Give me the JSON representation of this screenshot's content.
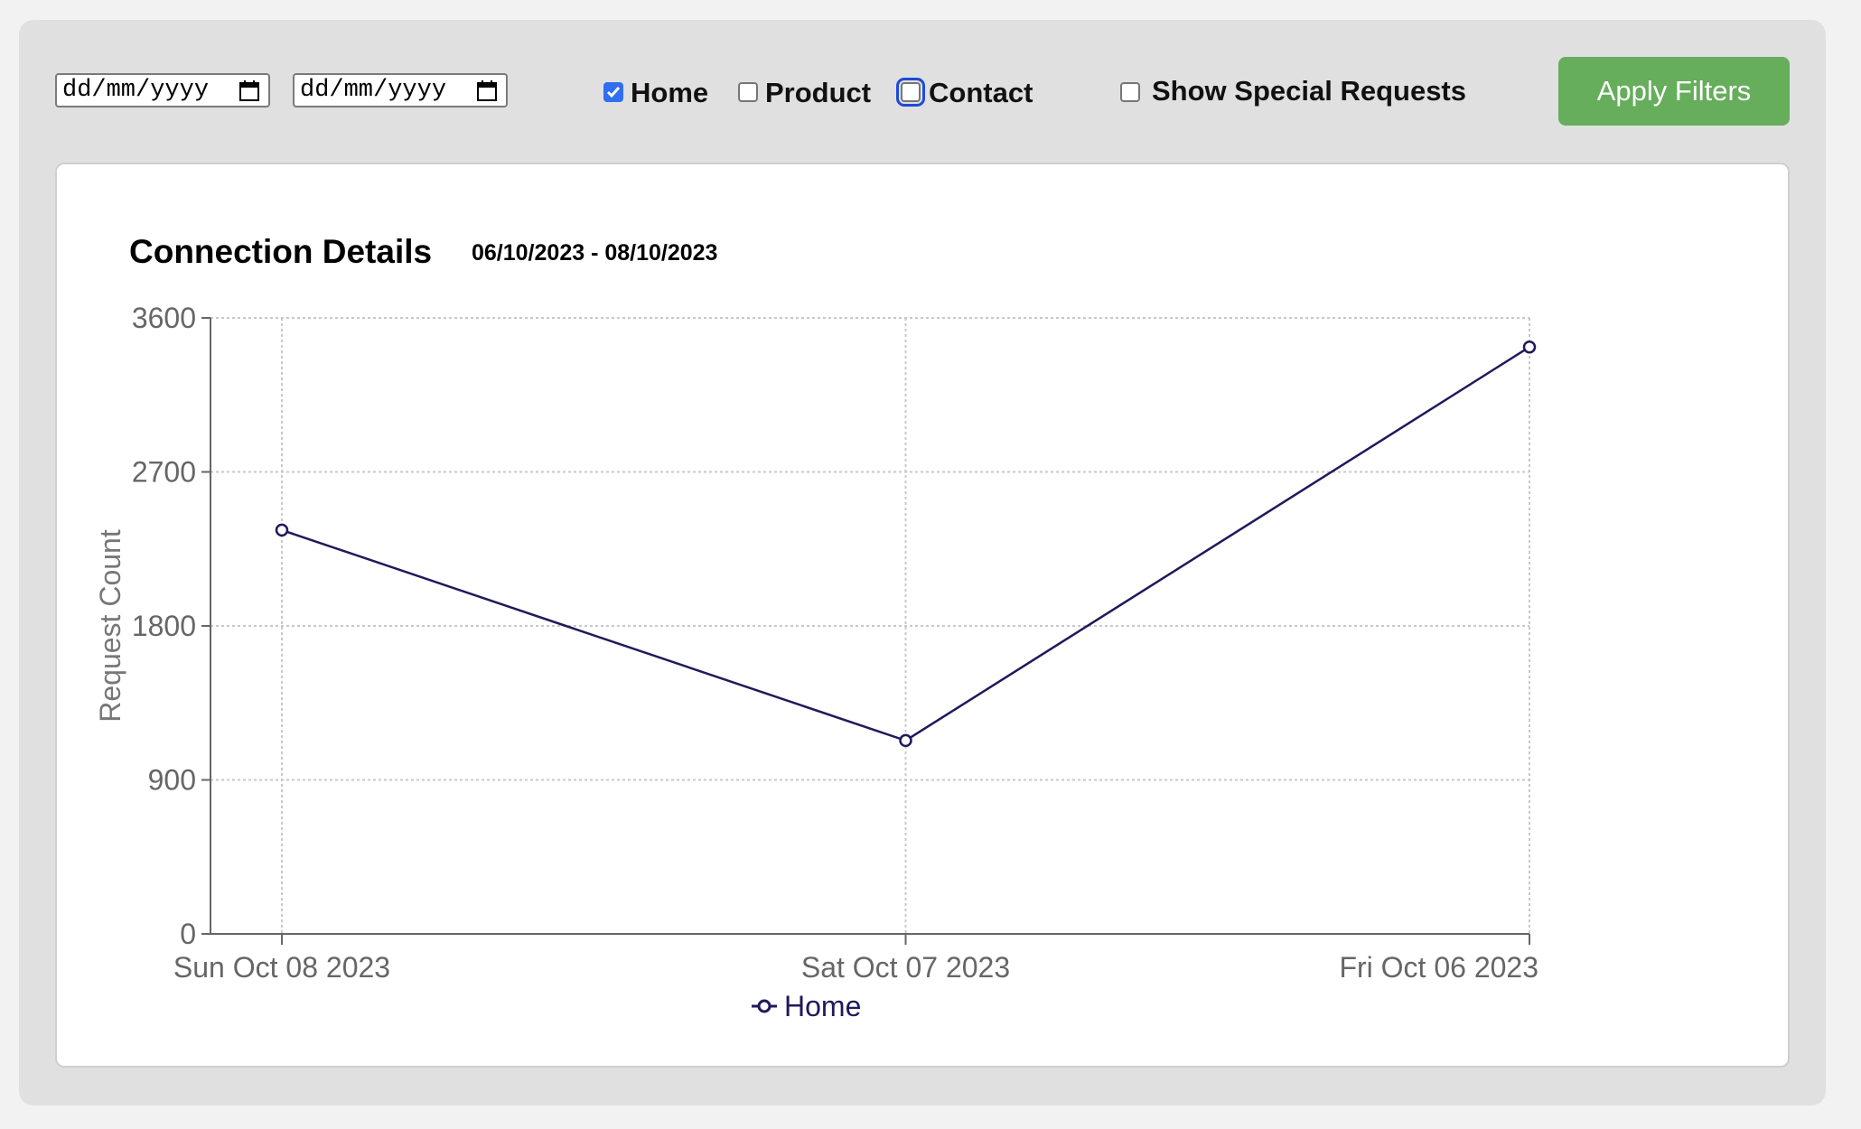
{
  "filters": {
    "start_date": {
      "placeholder": "dd/mm/yyyy"
    },
    "end_date": {
      "placeholder": "dd/mm/yyyy"
    },
    "checkboxes": [
      {
        "label": "Home",
        "checked": true
      },
      {
        "label": "Product",
        "checked": false
      },
      {
        "label": "Contact",
        "checked": false,
        "focused": true
      },
      {
        "label": "Show Special Requests",
        "checked": false
      }
    ],
    "apply_label": "Apply Filters"
  },
  "colors": {
    "accent_checkbox": "#2f6ff0",
    "apply_button": "#66ad5c",
    "series_line": "#1f1a5c"
  },
  "chart_data": {
    "type": "line",
    "title": "Connection Details",
    "subtitle": "06/10/2023 - 08/10/2023",
    "ylabel": "Request Count",
    "xlabel": "",
    "categories": [
      "Sun Oct 08 2023",
      "Sat Oct 07 2023",
      "Fri Oct 06 2023"
    ],
    "series": [
      {
        "name": "Home",
        "values": [
          2360,
          1130,
          3430
        ]
      }
    ],
    "ylim": [
      0,
      3600
    ],
    "yticks": [
      0,
      900,
      1800,
      2700,
      3600
    ],
    "grid": true,
    "legend": "bottom-center"
  }
}
